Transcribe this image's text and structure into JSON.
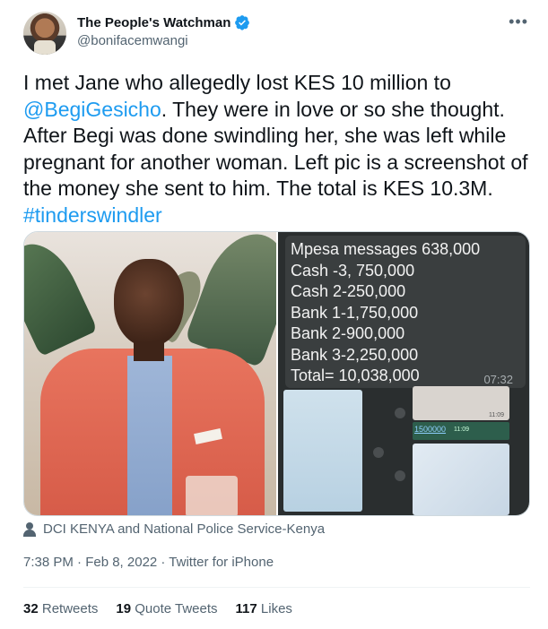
{
  "author": {
    "display_name": "The People's Watchman",
    "handle": "@bonifacemwangi"
  },
  "tweet": {
    "text_before": "I met Jane who allegedly lost KES 10 million to ",
    "mention": "@BegiGesicho",
    "text_after": ". They were in love or so she thought. After Begi was done swindling her, she was left while pregnant for another woman. Left pic is a screenshot of the money she sent to him. The total is KES 10.3M. ",
    "hashtag": "#tinderswindler"
  },
  "media": {
    "right_image": {
      "lines": [
        "Mpesa messages 638,000",
        "Cash -3, 750,000",
        "Cash 2-250,000",
        "Bank 1-1,750,000",
        "Bank 2-900,000",
        "Bank 3-2,250,000",
        "Total= 10,038,000"
      ],
      "time": "07:32",
      "bubble_time": "11:09",
      "amount": "1500000",
      "amount_time": "11:09"
    }
  },
  "caption": "DCI KENYA and National Police Service-Kenya",
  "meta": "7:38 PM · Feb 8, 2022 · Twitter for iPhone",
  "stats": {
    "retweets_count": "32",
    "retweets_label": "Retweets",
    "quotes_count": "19",
    "quotes_label": "Quote Tweets",
    "likes_count": "117",
    "likes_label": "Likes"
  },
  "colors": {
    "accent": "#1d9bf0",
    "muted_text": "#536471"
  }
}
